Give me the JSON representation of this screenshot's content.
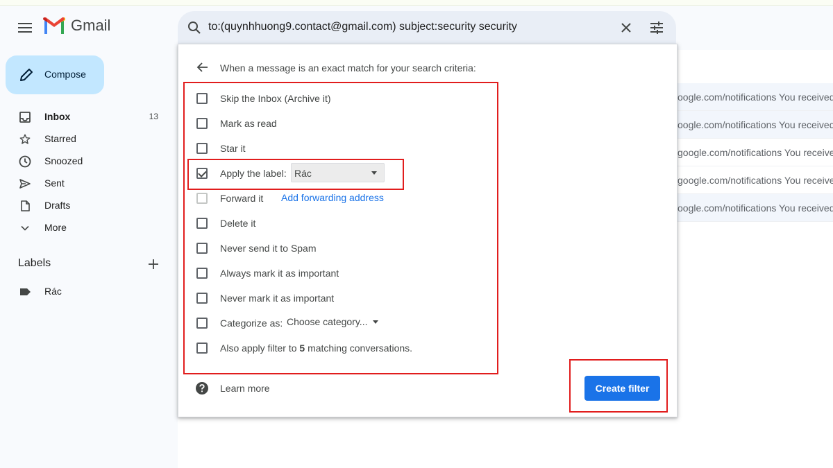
{
  "app": {
    "name": "Gmail"
  },
  "search": {
    "query": "to:(quynhhuong9.contact@gmail.com) subject:security security"
  },
  "sidebar": {
    "compose_label": "Compose",
    "items": [
      {
        "label": "Inbox",
        "count": "13",
        "icon": "inbox-icon"
      },
      {
        "label": "Starred",
        "count": "",
        "icon": "star-icon"
      },
      {
        "label": "Snoozed",
        "count": "",
        "icon": "clock-icon"
      },
      {
        "label": "Sent",
        "count": "",
        "icon": "send-icon"
      },
      {
        "label": "Drafts",
        "count": "",
        "icon": "draft-icon"
      },
      {
        "label": "More",
        "count": "",
        "icon": "chevron-down-icon"
      }
    ],
    "labels_heading": "Labels",
    "labels": [
      {
        "label": "Rác",
        "icon": "label-icon"
      }
    ]
  },
  "mail_rows": [
    "oogle.com/notifications You received",
    "oogle.com/notifications You received",
    "google.com/notifications You receive",
    "google.com/notifications You receive",
    "oogle.com/notifications You received"
  ],
  "filter_panel": {
    "criteria_text": "When a message is an exact match for your search criteria:",
    "options": [
      {
        "label": "Skip the Inbox (Archive it)",
        "checked": false
      },
      {
        "label": "Mark as read",
        "checked": false
      },
      {
        "label": "Star it",
        "checked": false
      },
      {
        "label": "Apply the label:",
        "checked": true
      },
      {
        "label": "Forward it",
        "checked": false
      },
      {
        "label": "Delete it",
        "checked": false
      },
      {
        "label": "Never send it to Spam",
        "checked": false
      },
      {
        "label": "Always mark it as important",
        "checked": false
      },
      {
        "label": "Never mark it as important",
        "checked": false
      },
      {
        "label": "Categorize as:",
        "checked": false
      },
      {
        "label_prefix": "Also apply filter to ",
        "count": "5",
        "label_suffix": " matching conversations.",
        "checked": false
      }
    ],
    "label_select_value": "Rác",
    "forward_link": "Add forwarding address",
    "category_select_value": "Choose category...",
    "learn_more": "Learn more",
    "create_button": "Create filter"
  },
  "colors": {
    "accent": "#1a73e8",
    "compose_bg": "#c2e7ff",
    "annotation": "#e11d1d"
  }
}
